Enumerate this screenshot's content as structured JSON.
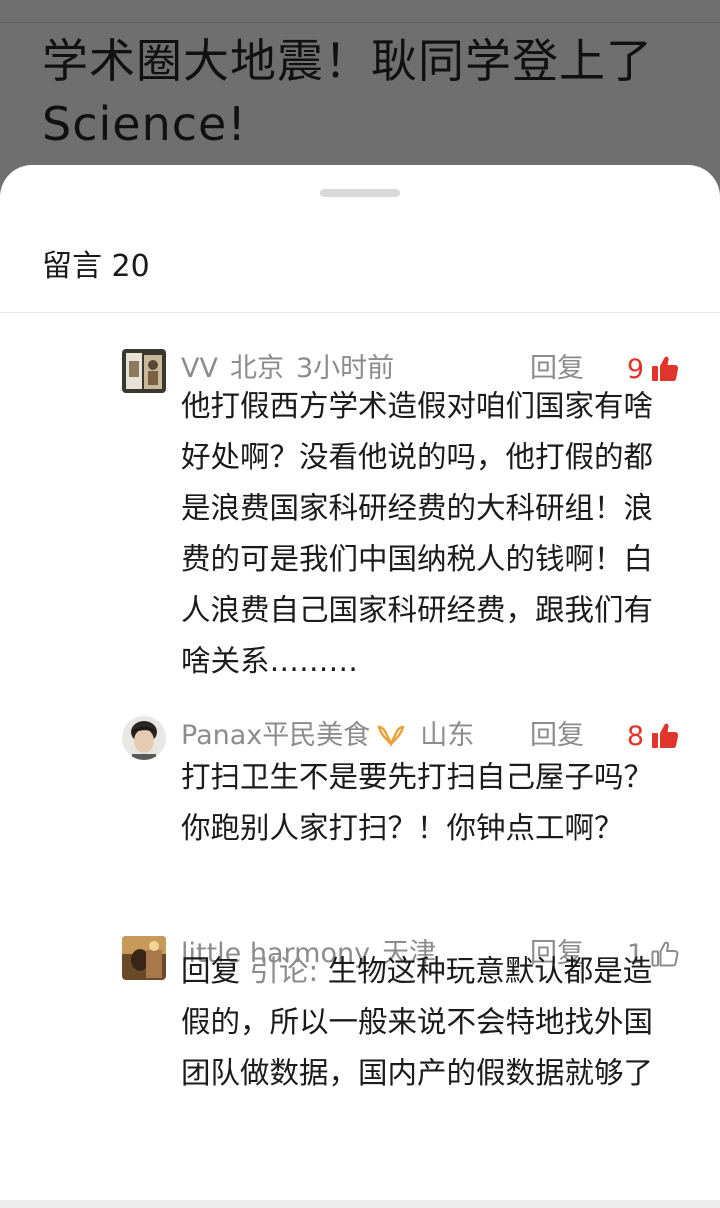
{
  "article": {
    "title": "学术圈大地震！耿同学登上了Science!"
  },
  "sheet": {
    "title": "留言 20"
  },
  "comments": [
    {
      "name": "VV",
      "location": "北京",
      "time": "3小时前",
      "reply_label": "回复",
      "likes": "9",
      "liked": true,
      "text": "他打假西方学术造假对咱们国家有啥好处啊？没看他说的吗，他打假的都是浪费国家科研经费的大科研组！浪费的可是我们中国纳税人的钱啊！白人浪费自己国家科研经费，跟我们有啥关系………"
    },
    {
      "name": "Panax平民美食",
      "location": "山东",
      "reply_label": "回复",
      "likes": "8",
      "liked": true,
      "text": "打扫卫生不是要先打扫自己屋子吗？你跑别人家打扫？！你钟点工啊？"
    },
    {
      "name": "little harmony",
      "location": "天津",
      "reply_label": "回复",
      "likes": "1",
      "liked": false,
      "text_prefix": "回复",
      "quote_prefix": "引论:",
      "text": "生物这种玩意默认都是造假的，所以一般来说不会特地找外国团队做数据，国内产的假数据就够了"
    }
  ],
  "colors": {
    "like_active": "#e0352b",
    "like_inactive": "#8c8c8c",
    "meta_text": "#8c8c8c",
    "backdrop": "#6f6f6f"
  }
}
